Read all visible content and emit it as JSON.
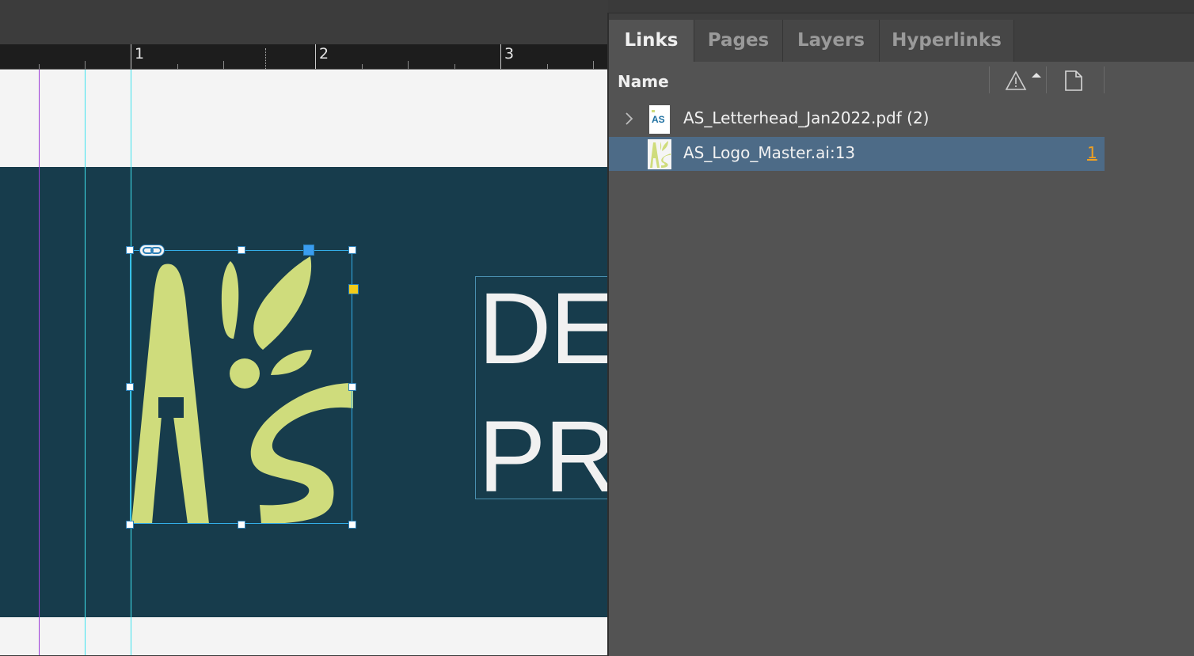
{
  "ruler": {
    "labels": [
      "1",
      "2",
      "3"
    ]
  },
  "document": {
    "headline_lines": [
      "DE",
      "PR"
    ],
    "colors": {
      "band": "#173c4c",
      "logo": "#cfdc7c",
      "page": "#f4f4f4"
    },
    "selected_frame": {
      "type": "placed-graphic",
      "content": "AS logo"
    }
  },
  "panel": {
    "tabs": [
      {
        "label": "Links",
        "active": true
      },
      {
        "label": "Pages",
        "active": false
      },
      {
        "label": "Layers",
        "active": false
      },
      {
        "label": "Hyperlinks",
        "active": false
      }
    ],
    "columns": {
      "name": "Name",
      "status_icon": "warning-triangle-icon",
      "page_icon": "page-icon"
    },
    "links": [
      {
        "name": "AS_Letterhead_Jan2022.pdf (2)",
        "expandable": true,
        "thumbnail": "letterhead-thumbnail",
        "selected": false,
        "page": ""
      },
      {
        "name": "AS_Logo_Master.ai:13",
        "expandable": false,
        "thumbnail": "logo-thumbnail",
        "selected": true,
        "page": "1"
      }
    ]
  }
}
